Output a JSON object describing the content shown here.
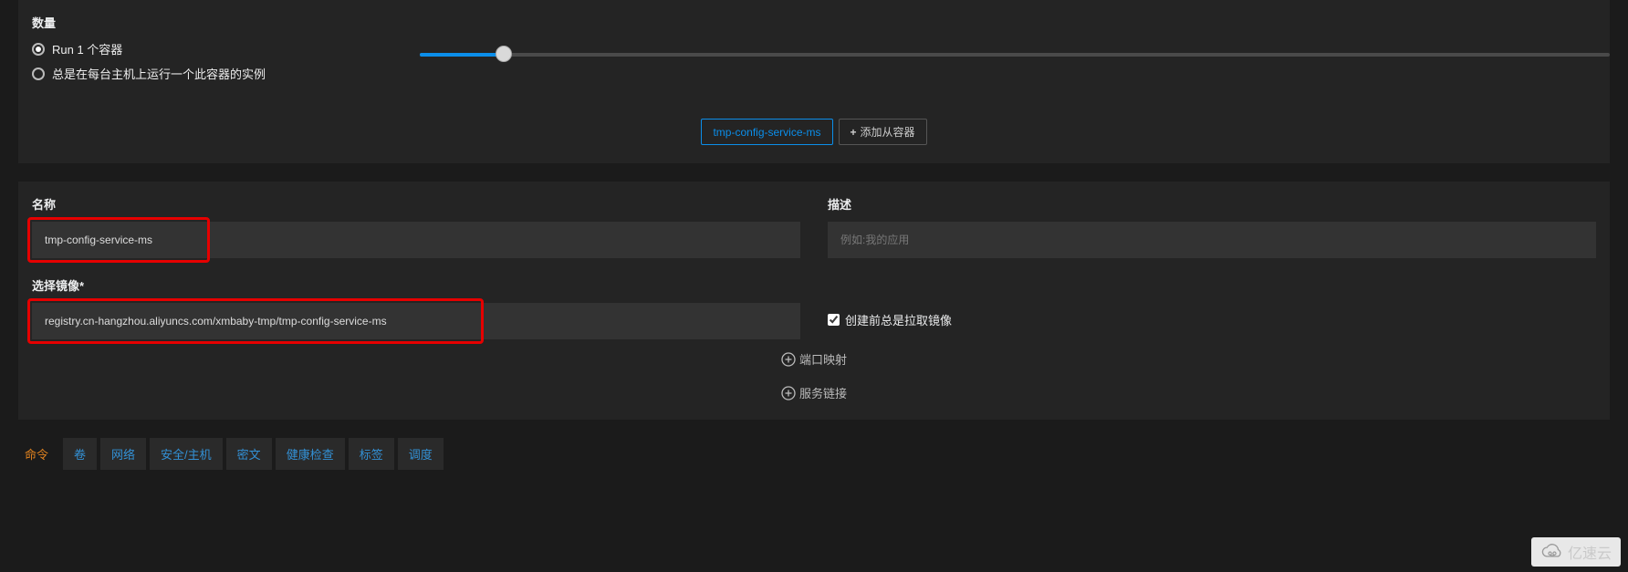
{
  "quantity": {
    "label": "数量",
    "option_run": "Run 1 个容器",
    "option_every_host": "总是在每台主机上运行一个此容器的实例"
  },
  "containerTabs": {
    "active": "tmp-config-service-ms",
    "add": "添加从容器"
  },
  "form": {
    "name_label": "名称",
    "name_value": "tmp-config-service-ms",
    "desc_label": "描述",
    "desc_placeholder": "例如:我的应用",
    "image_label": "选择镜像*",
    "image_value": "registry.cn-hangzhou.aliyuncs.com/xmbaby-tmp/tmp-config-service-ms",
    "pull_always_label": "创建前总是拉取镜像",
    "port_mapping": "端口映射",
    "service_links": "服务链接"
  },
  "tabs": {
    "command": "命令",
    "volumes": "卷",
    "network": "网络",
    "security": "安全/主机",
    "secrets": "密文",
    "health": "健康检查",
    "labels": "标签",
    "schedule": "调度"
  },
  "watermark": "亿速云"
}
